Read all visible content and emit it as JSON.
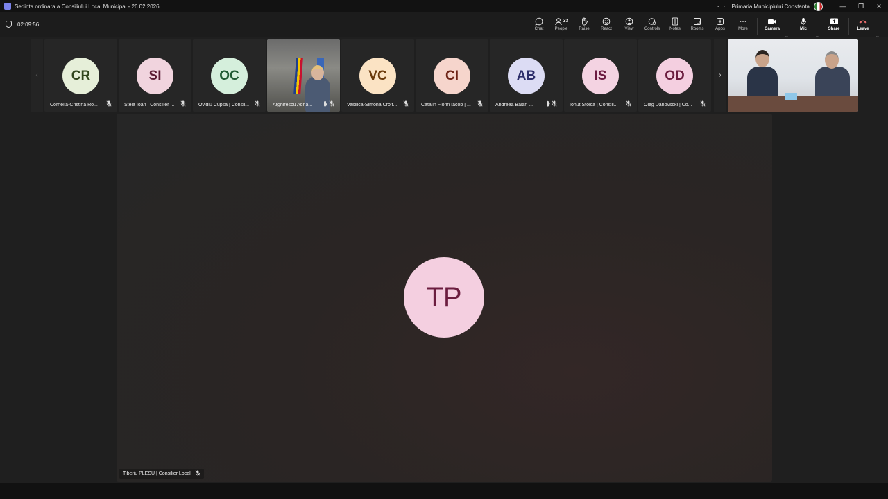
{
  "window": {
    "title": "Sedinta ordinara a Consiliului Local Municipal - 26.02.2026",
    "more_dots": "···",
    "org_name": "Primaria Municipiului Constanta",
    "minimize": "—",
    "restore": "❐",
    "close": "✕"
  },
  "meeting": {
    "elapsed": "02:09:56"
  },
  "toolbar": {
    "chat": "Chat",
    "people": "People",
    "people_count": "33",
    "raise": "Raise",
    "react": "React",
    "view": "View",
    "controls": "Controls",
    "notes": "Notes",
    "rooms": "Rooms",
    "apps": "Apps",
    "more": "More",
    "camera": "Camera",
    "mic": "Mic",
    "share": "Share",
    "leave": "Leave"
  },
  "participants": [
    {
      "initials": "CR",
      "name": "Cornelia-Cristina Ro...",
      "bg": "#e6efd9",
      "fg": "#30451d"
    },
    {
      "initials": "SI",
      "name": "Stela Ioan | Consilier ...",
      "bg": "#f1d4de",
      "fg": "#5b1c34"
    },
    {
      "initials": "OC",
      "name": "Ovidiu Cupsa | Consil...",
      "bg": "#d5efdc",
      "fg": "#1f5a33"
    },
    {
      "initials": "",
      "name": "Arghirescu Adria...",
      "bg": "",
      "fg": ""
    },
    {
      "initials": "VC",
      "name": "Vasilica-Simona Croit...",
      "bg": "#fbe3c4",
      "fg": "#6b3a0b"
    },
    {
      "initials": "CI",
      "name": "Catalin Florin Iacob | ...",
      "bg": "#f6d5cc",
      "fg": "#6e2417"
    },
    {
      "initials": "AB",
      "name": "Andreea Bălan ...",
      "bg": "#dcdcf4",
      "fg": "#2d2e6b"
    },
    {
      "initials": "IS",
      "name": "Ionut Stoica | Consili...",
      "bg": "#f4d3e2",
      "fg": "#6d1c43"
    },
    {
      "initials": "OD",
      "name": "Oleg Danovscki | Co...",
      "bg": "#f4cfe0",
      "fg": "#6b1d3f"
    }
  ],
  "main_speaker": {
    "initials": "TP",
    "name": "Tiberiu PLESU | Consilier Local"
  },
  "icons": {
    "mic_off": "🎙",
    "hand": "✋",
    "prev": "‹",
    "next": "›",
    "chevron": "⌄"
  }
}
